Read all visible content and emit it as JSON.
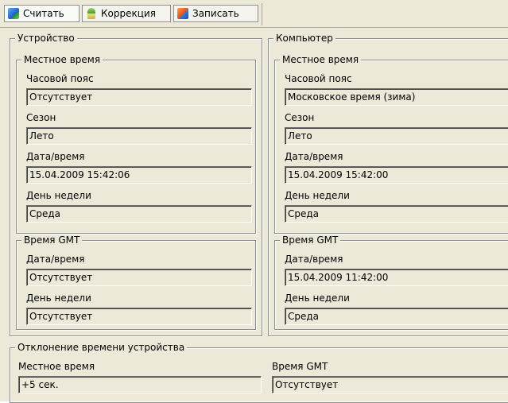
{
  "toolbar": {
    "read_label": "Считать",
    "correct_label": "Коррекция",
    "write_label": "Записать"
  },
  "device": {
    "title": "Устройство",
    "local": {
      "title": "Местное время",
      "timezone_label": "Часовой пояс",
      "timezone_value": "Отсутствует",
      "season_label": "Сезон",
      "season_value": "Лето",
      "datetime_label": "Дата/время",
      "datetime_value": "15.04.2009 15:42:06",
      "weekday_label": "День недели",
      "weekday_value": "Среда"
    },
    "gmt": {
      "title": "Время GMT",
      "datetime_label": "Дата/время",
      "datetime_value": "Отсутствует",
      "weekday_label": "День недели",
      "weekday_value": "Отсутствует"
    }
  },
  "computer": {
    "title": "Компьютер",
    "local": {
      "title": "Местное время",
      "timezone_label": "Часовой пояс",
      "timezone_value": "Московское время (зима)",
      "season_label": "Сезон",
      "season_value": "Лето",
      "datetime_label": "Дата/время",
      "datetime_value": "15.04.2009 15:42:00",
      "weekday_label": "День недели",
      "weekday_value": "Среда"
    },
    "gmt": {
      "title": "Время GMT",
      "datetime_label": "Дата/время",
      "datetime_value": "15.04.2009 11:42:00",
      "weekday_label": "День недели",
      "weekday_value": "Среда"
    }
  },
  "deviation": {
    "title": "Отклонение времени устройства",
    "local_label": "Местное время",
    "local_value": "+5 сек.",
    "gmt_label": "Время GMT",
    "gmt_value": "Отсутствует"
  },
  "icons": {
    "read": "read-device-icon",
    "correct": "correction-icon",
    "write": "write-device-icon"
  }
}
